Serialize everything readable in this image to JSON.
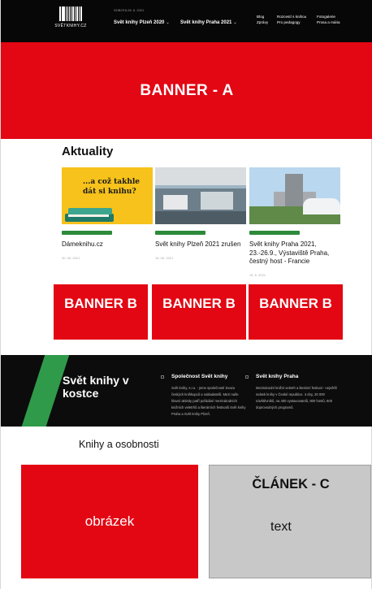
{
  "nav": {
    "brand": "SVĚTKNIHY.CZ",
    "date": "SOBOTA 26. 6. 2021",
    "links": [
      "Svět knihy Plzeň 2020",
      "Svět knihy Praha 2021"
    ],
    "right_col1": [
      "Blog",
      "Zprávy"
    ],
    "right_col2": [
      "Rozcestí s knihou",
      "Pro pedagogy"
    ],
    "right_col3": [
      "Fotogalerie",
      "Prosa a mária"
    ]
  },
  "banner_a": "BANNER - A",
  "news": {
    "title": "Aktuality",
    "cards": [
      {
        "image_text": "...a což takhle dát si knihu?",
        "title": "Dámeknihu.cz",
        "date": "30. 06. 2021"
      },
      {
        "title": "Svět knihy Plzeň 2021 zrušen",
        "date": "18. 06. 2021"
      },
      {
        "title": "Svět knihy Praha 2021, 23.-26.9., Výstaviště Praha, čestný host - Francie",
        "date": "15. 6. 2021"
      }
    ]
  },
  "banner_b": [
    "BANNER B",
    "BANNER B",
    "BANNER B"
  ],
  "about": {
    "title": "Svět knihy v kostce",
    "columns": [
      {
        "heading": "Společnost Svět knihy",
        "body": "Svět knihy, s.r.o. - jsme společností Svazu českých knihkupců a nakladatelů. Mezi naše hlavní aktivity patří pořádání mezinárodních knižních veletrhů a literárních festivalů Svět knihy Praha a Svět knihy Plzeň."
      },
      {
        "heading": "Svět knihy Praha",
        "body": "Mezinárodní knižní veletrh a literární festival - největší svátek knihy v České republice. 4 dny, 20 000 návštěvníků, na 400 vystavovatelů, 800 hostů, 600 doprovodných programů."
      }
    ]
  },
  "people": {
    "title": "Knihy a osobnosti",
    "image_label": "obrázek",
    "article_heading": "ČLÁNEK - C",
    "article_text": "text"
  },
  "colors": {
    "accent_red": "#e30613",
    "dark": "#0c0c0c",
    "green": "#2f9a4a",
    "grey_panel": "#c8c8c8"
  }
}
